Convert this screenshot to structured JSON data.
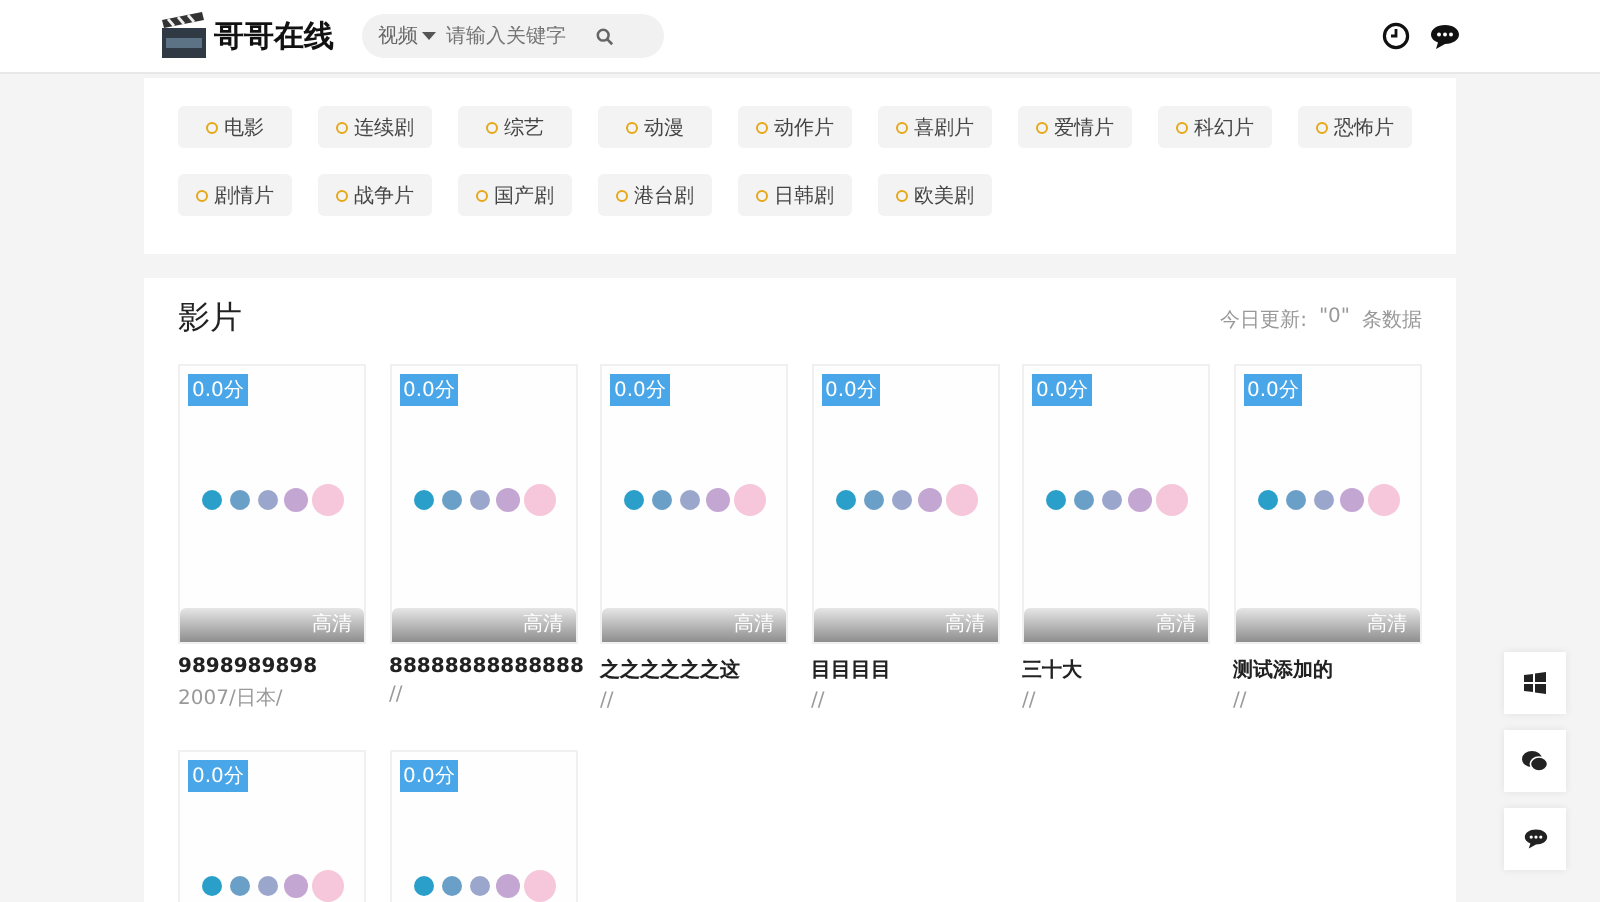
{
  "header": {
    "site_name": "哥哥在线",
    "search": {
      "scope": "视频",
      "placeholder": "请输入关键字"
    }
  },
  "categories": [
    "电影",
    "连续剧",
    "综艺",
    "动漫",
    "动作片",
    "喜剧片",
    "爱情片",
    "科幻片",
    "恐怖片",
    "剧情片",
    "战争片",
    "国产剧",
    "港台剧",
    "日韩剧",
    "欧美剧"
  ],
  "section": {
    "title": "影片",
    "update_label": "今日更新:",
    "update_count": "\"0\"",
    "update_unit": "条数据"
  },
  "movies": [
    {
      "rating": "0.0分",
      "quality": "高清",
      "title": "9898989898",
      "meta": "2007/日本/"
    },
    {
      "rating": "0.0分",
      "quality": "高清",
      "title": "88888888888888",
      "meta": "//"
    },
    {
      "rating": "0.0分",
      "quality": "高清",
      "title": "之之之之之之这",
      "meta": "//"
    },
    {
      "rating": "0.0分",
      "quality": "高清",
      "title": "目目目目",
      "meta": "//"
    },
    {
      "rating": "0.0分",
      "quality": "高清",
      "title": "三十大",
      "meta": "//"
    },
    {
      "rating": "0.0分",
      "quality": "高清",
      "title": "测试添加的",
      "meta": "//"
    },
    {
      "rating": "0.0分"
    },
    {
      "rating": "0.0分"
    }
  ]
}
